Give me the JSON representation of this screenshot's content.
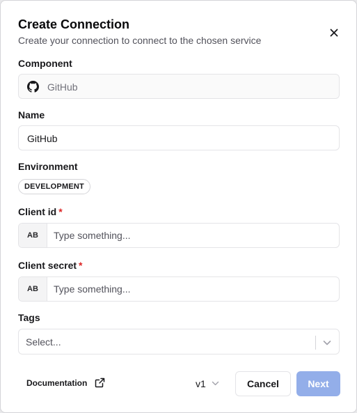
{
  "dialog": {
    "title": "Create Connection",
    "subtitle": "Create your connection to connect to the chosen service",
    "close_icon": "close-icon"
  },
  "component": {
    "label": "Component",
    "value": "GitHub",
    "icon": "github-icon"
  },
  "name": {
    "label": "Name",
    "value": "GitHub"
  },
  "environment": {
    "label": "Environment",
    "badge": "DEVELOPMENT"
  },
  "client_id": {
    "label": "Client id",
    "required_mark": "*",
    "prefix": "AB",
    "placeholder": "Type something..."
  },
  "client_secret": {
    "label": "Client secret",
    "required_mark": "*",
    "prefix": "AB",
    "placeholder": "Type something..."
  },
  "tags": {
    "label": "Tags",
    "placeholder": "Select...",
    "icon": "chevron-down-icon"
  },
  "footer": {
    "documentation_label": "Documentation",
    "documentation_icon": "external-link-icon",
    "version": "v1",
    "cancel_label": "Cancel",
    "next_label": "Next"
  },
  "colors": {
    "primary_disabled": "#93aee9",
    "required": "#dc2626",
    "border": "#e4e4e7"
  }
}
